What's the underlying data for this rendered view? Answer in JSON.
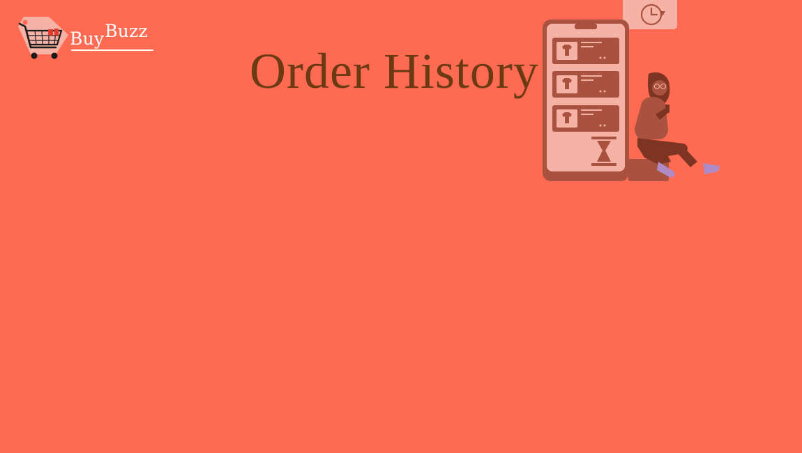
{
  "brand": {
    "name_part1": "Buy",
    "name_part2": "Buzz"
  },
  "header": {
    "title": "Order History"
  },
  "illustration": {
    "icons": [
      "history-clock-icon",
      "tshirt-icon",
      "hourglass-icon"
    ]
  },
  "colors": {
    "background": "#FF6A52",
    "title": "#6B3A12",
    "brand_text": "#FFFFFF",
    "phone_frame": "#A9523F",
    "phone_screen": "#F6B2A5",
    "order_card": "#A9523F",
    "card_tag": "#F6B2A5",
    "figure_skin": "#A9523F",
    "figure_dark": "#7E3422",
    "shoe": "#B08AC4"
  }
}
